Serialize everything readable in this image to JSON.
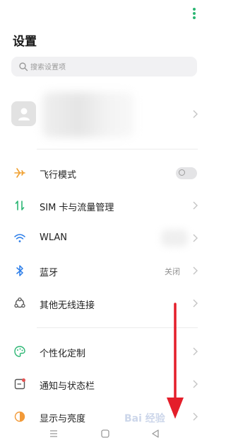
{
  "header": {
    "title": "设置",
    "more_icon": "more-vertical-icon"
  },
  "search": {
    "placeholder": "搜索设置项",
    "icon": "search-icon"
  },
  "account": {
    "icon": "user-avatar-icon"
  },
  "rows": [
    {
      "label": "飞行模式",
      "icon": "airplane-icon",
      "color": "#f0a030",
      "control": "toggle",
      "toggle_on": false
    },
    {
      "label": "SIM 卡与流量管理",
      "icon": "sim-data-icon",
      "color": "#2bb673",
      "control": "chevron"
    },
    {
      "label": "WLAN",
      "icon": "wifi-icon",
      "color": "#2b7de9",
      "control": "chevron"
    },
    {
      "label": "蓝牙",
      "icon": "bluetooth-icon",
      "color": "#2b7de9",
      "value": "关闭",
      "control": "chevron"
    },
    {
      "label": "其他无线连接",
      "icon": "wireless-connections-icon",
      "color": "#555555",
      "control": "chevron"
    },
    {
      "label": "个性化定制",
      "icon": "palette-icon",
      "color": "#2bb673",
      "control": "chevron"
    },
    {
      "label": "通知与状态栏",
      "icon": "notification-icon",
      "color": "#e55353",
      "control": "chevron"
    },
    {
      "label": "显示与亮度",
      "icon": "brightness-icon",
      "color": "#f29a38",
      "control": "chevron"
    }
  ],
  "navbar": {
    "icons": [
      "menu-icon",
      "home-icon",
      "back-icon"
    ]
  },
  "annotation": {
    "arrow_color": "#e41e2a"
  },
  "watermark": {
    "text": "Bai 经验"
  }
}
